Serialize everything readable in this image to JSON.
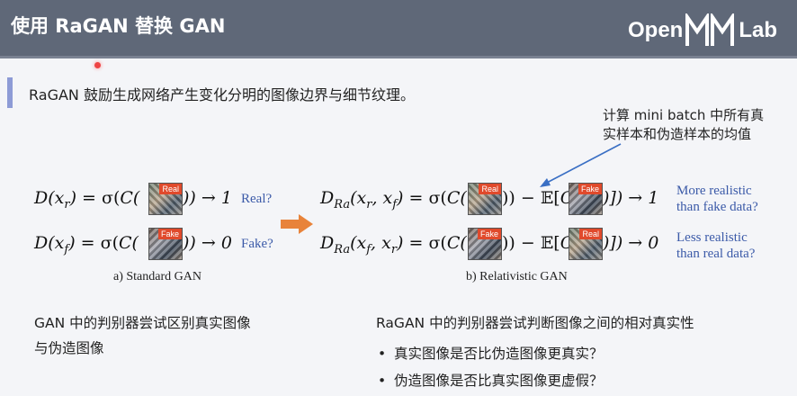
{
  "header": {
    "title": "使用 RaGAN 替换 GAN",
    "logo_left": "Open",
    "logo_right": "Lab"
  },
  "intro": "RaGAN 鼓励生成网络产生变化分明的图像边界与细节纹理。",
  "annotation": {
    "line1": "计算 mini batch 中所有真",
    "line2": "实样本和伪造样本的均值"
  },
  "standard": {
    "real_q": "Real?",
    "fake_q": "Fake?",
    "caption": "a) Standard GAN",
    "tag_real": "Real",
    "tag_fake": "Fake",
    "result_real": ")) → 1",
    "result_fake": ")) → 0"
  },
  "relativistic": {
    "q1_line1": "More realistic",
    "q1_line2": "than fake data?",
    "q2_line1": "Less realistic",
    "q2_line2": "than real data?",
    "caption": "b) Relativistic GAN",
    "result_1": ")]) → 1",
    "result_0": ")]) → 0"
  },
  "left_text": {
    "line1": "GAN 中的判别器尝试区别真实图像",
    "line2": "与伪造图像"
  },
  "right_text": {
    "heading": "RaGAN 中的判别器尝试判断图像之间的相对真实性",
    "bullets": [
      "真实图像是否比伪造图像更真实？",
      "伪造图像是否比真实图像更虚假？"
    ]
  },
  "colors": {
    "header_bg": "#5f6878",
    "accent_bar": "#8d9bd6",
    "arrow": "#e8833a",
    "question_text": "#3b5aa8",
    "tag": "#e04a2c"
  }
}
